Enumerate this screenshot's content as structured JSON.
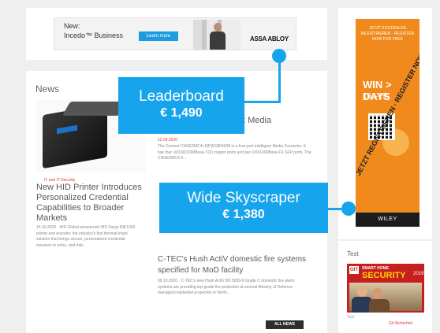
{
  "top_banner": {
    "line1": "New:",
    "line2": "Incedo™ Business",
    "button": "Learn more",
    "brand": "ASSA ABLOY"
  },
  "news": {
    "section_title": "News",
    "left_article": {
      "tag": "IT and IT-Security",
      "headline": "New HID Printer Introduces Personalized Credential Capabilities to Broader Markets",
      "excerpt": "15.10.2020 · HID Global announced HID Fargo INK1000 printer and encoder, the industry's first thermal inkjet solution that brings secure, personalized credential issuance to entry- and mid..."
    },
    "mid_article_1": {
      "headline_fragment": "t Media",
      "date": "12.09.2020",
      "excerpt": "The Comnet CNGE2MC4+2(P)EGBHS/M is a four-port intelligent Media Converter. It has four 10/100/1000Base-T(X) copper ports and two 100/1000Base-FX SFP ports. The CNGE2MC4-2..."
    },
    "mid_article_2": {
      "headline": "C-TEC's Hush ActiV domestic fire systems specified for MoD facility",
      "excerpt": "09.10.2020 · C-TEC's new Hush ActiV BS 5839-6 Grade C domestic fire alarm systems are providing top-grade fire protection at several Ministry of Defence-managed residential properties in North..."
    },
    "all_news_button": "ALL NEWS"
  },
  "skyscraper_ad": {
    "top_text": "JETZT KOSTENLOS REGISTRIEREN · REGISTER NOW FOR FREE",
    "win": "WIN > DAYS",
    "dates": "16.–19.",
    "diagonal": "JETZT REGISTRIEREN · REGISTER NOW",
    "publisher": "WILEY"
  },
  "test_widget": {
    "title": "Test",
    "mag_logo": "GIT",
    "mag_line1": "SMART HOME",
    "mag_line2": "SECURITY",
    "mag_year": "2019",
    "caption": "Test",
    "link": "Git Sicherheit"
  },
  "callouts": {
    "leaderboard": {
      "name": "Leaderboard",
      "price": "€ 1,490"
    },
    "skyscraper": {
      "name": "Wide Skyscraper",
      "price": "€ 1,380"
    }
  },
  "colors": {
    "accent": "#16a4ec",
    "ad_orange": "#f08a1c",
    "tag_red": "#d83a3a"
  }
}
